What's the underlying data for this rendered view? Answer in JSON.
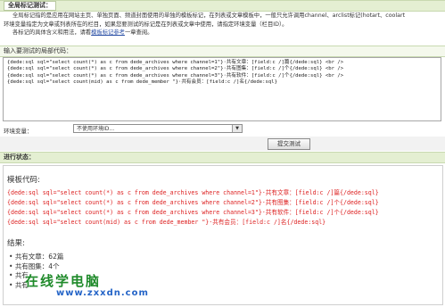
{
  "section1": {
    "title": "全局标记测试："
  },
  "intro": {
    "line1": "全局标记指的是应用在网站主页、单独页面、频道封面使用的单独的模板标记，在列表或文章模板中，一般只允许调用channel、arclist标记(hotart、coolart",
    "line2": "环境变量指定为文章或列表所在的栏目，如果您要测试的标记是在列表或文章中使用，请指定环境变量（栏目ID）。",
    "line3_prefix": "各标记的具体含义和用法，请看",
    "line3_link": "模板标记参考",
    "line3_suffix": "一章查阅。"
  },
  "input_label": "输入要测试的局部代码：",
  "code": {
    "lines": [
      "{dede:sql sql=\"select count(*) as c from dede_archives where channel=1\"}·共有文章：[field:c /]篇{/dede:sql} <br />",
      "{dede:sql sql=\"select count(*) as c from dede_archives where channel=2\"}·共有图集：[field:c /]个{/dede:sql} <br />",
      "{dede:sql sql=\"select count(*) as c from dede_archives where channel=3\"}·共有软件：[field:c /]个{/dede:sql} <br />",
      "{dede:sql sql=\"select count(mid) as c from dede_member \"}·共有会员：[field:c /]名{/dede:sql}"
    ]
  },
  "env": {
    "label": "环境变量：",
    "selected": "不使用环境ID..."
  },
  "submit_label": "提交测试",
  "section2": {
    "title": "进行状态："
  },
  "results": {
    "template_label": "模板代码:",
    "code_lines": [
      "{dede:sql sql=\"select count(*) as c from dede_archives where channel=1\"}·共有文章：[field:c /]篇{/dede:sql}",
      "{dede:sql sql=\"select count(*) as c from dede_archives where channel=2\"}·共有图集：[field:c /]个{/dede:sql}",
      "{dede:sql sql=\"select count(*) as c from dede_archives where channel=3\"}·共有软件：[field:c /]个{/dede:sql}",
      "{dede:sql sql=\"select count(mid) as c from dede_member \"}·共有会员：[field:c /]名{/dede:sql}"
    ],
    "result_label": "结果:",
    "items": [
      "共有文章：62篇",
      "共有图集：4个",
      "共有",
      "共有"
    ]
  },
  "watermark": {
    "line1": "在线学电脑",
    "line2": "www.zxxdn.com"
  }
}
